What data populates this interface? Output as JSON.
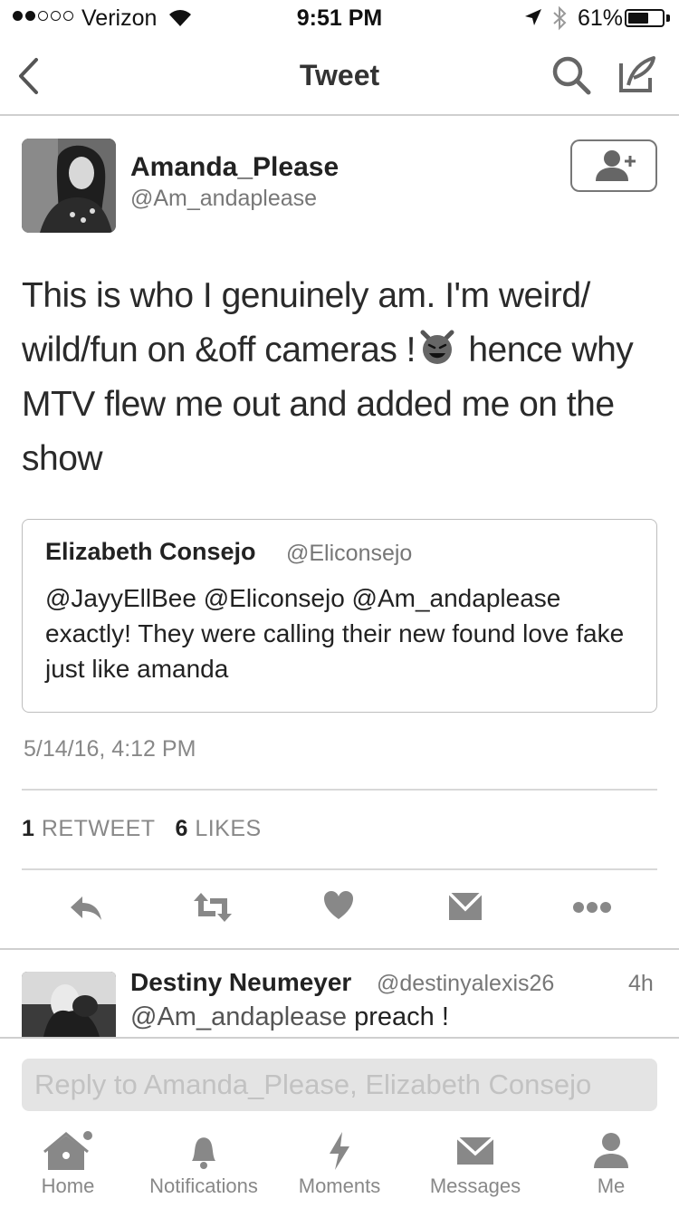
{
  "status_bar": {
    "carrier": "Verizon",
    "time": "9:51 PM",
    "battery": "61%",
    "battery_level": 0.61
  },
  "nav": {
    "title": "Tweet"
  },
  "tweet": {
    "author_name": "Amanda_Please",
    "author_handle": "@Am_andaplease",
    "text_part1": "This is who I genuinely am. I'm weird/ wild/fun on &off cameras !",
    "text_part2": " hence why MTV flew me out and added me on the show",
    "emoji_icon": "smiling-devil-emoji",
    "date": "5/14/16, 4:12 PM",
    "retweet_count": "1",
    "retweet_label": "RETWEET",
    "like_count": "6",
    "like_label": "LIKES"
  },
  "quote": {
    "name": "Elizabeth Consejo",
    "handle": "@Eliconsejo",
    "text": "@JayyEllBee @Eliconsejo @Am_andaplease exactly! They were calling their new found love fake just like amanda"
  },
  "actions": [
    "reply-icon",
    "retweet-icon",
    "heart-icon",
    "direct-message-icon",
    "more-icon"
  ],
  "reply_item": {
    "name": "Destiny Neumeyer",
    "handle": "@destinyalexis26",
    "time": "4h",
    "mention": "@Am_andaplease",
    "text": " preach !"
  },
  "composer": {
    "placeholder": "Reply to Amanda_Please, Elizabeth Consejo"
  },
  "tabs": [
    {
      "label": "Home",
      "icon": "home-icon"
    },
    {
      "label": "Notifications",
      "icon": "bell-icon"
    },
    {
      "label": "Moments",
      "icon": "lightning-icon"
    },
    {
      "label": "Messages",
      "icon": "envelope-icon"
    },
    {
      "label": "Me",
      "icon": "person-icon"
    }
  ]
}
